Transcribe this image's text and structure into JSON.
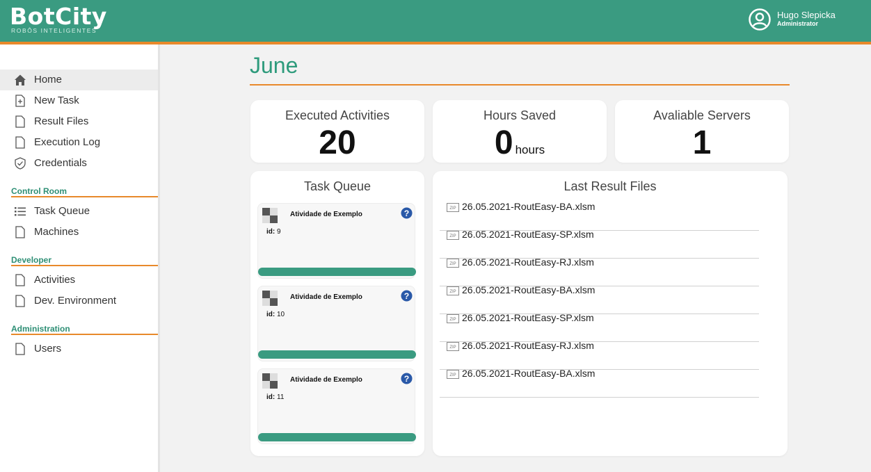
{
  "brand": {
    "name": "BotCity",
    "tagline": "ROBÔS INTELIGENTES",
    "primary_color": "#3a9b81",
    "accent_color": "#e8892b"
  },
  "user": {
    "name": "Hugo Slepicka",
    "role": "Administrator",
    "icon": "user-avatar-icon"
  },
  "sidebar": {
    "items": [
      {
        "label": "Home",
        "icon": "home-icon",
        "active": true
      },
      {
        "label": "New Task",
        "icon": "new-file-icon"
      },
      {
        "label": "Result Files",
        "icon": "file-icon"
      },
      {
        "label": "Execution Log",
        "icon": "file-icon"
      },
      {
        "label": "Credentials",
        "icon": "shield-check-icon"
      }
    ],
    "sections": [
      {
        "title": "Control Room",
        "items": [
          {
            "label": "Task Queue",
            "icon": "list-icon"
          },
          {
            "label": "Machines",
            "icon": "file-icon"
          }
        ]
      },
      {
        "title": "Developer",
        "items": [
          {
            "label": "Activities",
            "icon": "file-icon"
          },
          {
            "label": "Dev. Environment",
            "icon": "file-icon"
          }
        ]
      },
      {
        "title": "Administration",
        "items": [
          {
            "label": "Users",
            "icon": "file-icon"
          }
        ]
      }
    ]
  },
  "main": {
    "title": "June",
    "stats": [
      {
        "title": "Executed Activities",
        "value": "20"
      },
      {
        "title": "Hours Saved",
        "value": "0",
        "unit": "hours"
      },
      {
        "title": "Avaliable Servers",
        "value": "1"
      }
    ],
    "task_queue": {
      "title": "Task Queue",
      "id_label": "id:",
      "tasks": [
        {
          "name": "Atividade de Exemplo",
          "id": "9",
          "progress": 1.0
        },
        {
          "name": "Atividade de Exemplo",
          "id": "10",
          "progress": 1.0
        },
        {
          "name": "Atividade de Exemplo",
          "id": "11",
          "progress": 1.0
        }
      ]
    },
    "result_files": {
      "title": "Last Result Files",
      "icon": "zip-file-icon",
      "files": [
        "26.05.2021-RoutEasy-BA.xlsm",
        "26.05.2021-RoutEasy-SP.xlsm",
        "26.05.2021-RoutEasy-RJ.xlsm",
        "26.05.2021-RoutEasy-BA.xlsm",
        "26.05.2021-RoutEasy-SP.xlsm",
        "26.05.2021-RoutEasy-RJ.xlsm",
        "26.05.2021-RoutEasy-BA.xlsm"
      ]
    }
  }
}
